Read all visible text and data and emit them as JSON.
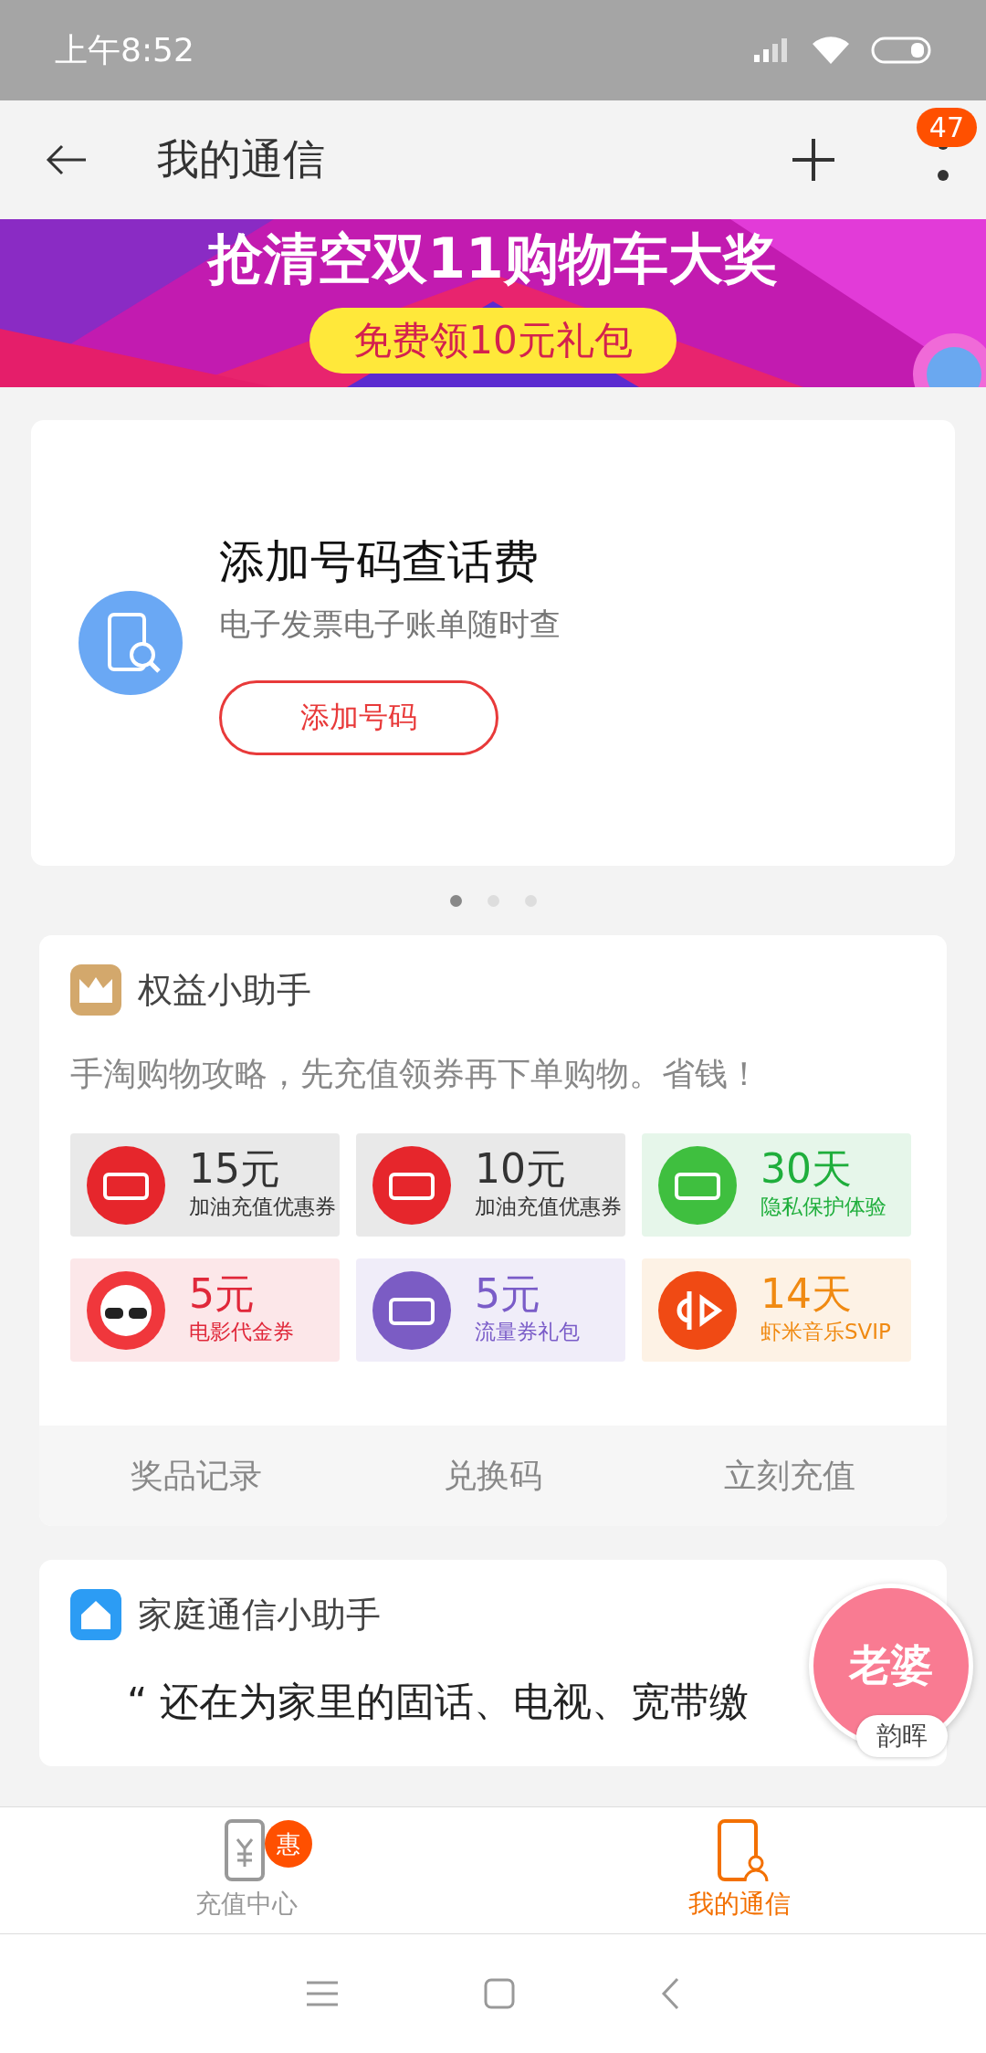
{
  "status_bar": {
    "time": "上午8:52"
  },
  "app_bar": {
    "title": "我的通信",
    "badge": "47"
  },
  "banner": {
    "headline": "抢清空双11购物车大奖",
    "button": "免费领10元礼包"
  },
  "carousel": {
    "title": "添加号码查话费",
    "subtitle": "电子发票电子账单随时查",
    "button": "添加号码",
    "dots": [
      {
        "selected": true
      },
      {
        "selected": false
      },
      {
        "selected": false
      }
    ]
  },
  "benefits": {
    "title": "权益小助手",
    "tip": "手淘购物攻略，先充值领券再下单购物。省钱！",
    "coupons": [
      {
        "kind": "fuel",
        "value": "15元",
        "label": "加油充值优惠券",
        "color": "#333333"
      },
      {
        "kind": "fuel",
        "value": "10元",
        "label": "加油充值优惠券",
        "color": "#333333"
      },
      {
        "kind": "privacy",
        "value": "30天",
        "label": "隐私保护体验",
        "color": "#1fae3c"
      },
      {
        "kind": "movie",
        "value": "5元",
        "label": "电影代金券",
        "color": "#e0283a"
      },
      {
        "kind": "data",
        "value": "5元",
        "label": "流量券礼包",
        "color": "#7a5cc8"
      },
      {
        "kind": "music",
        "value": "14天",
        "label": "虾米音乐SVIP",
        "color": "#f08a12"
      }
    ],
    "links": [
      "奖品记录",
      "兑换码",
      "立刻充值"
    ]
  },
  "family": {
    "title": "家庭通信小助手",
    "quote": "“ 还在为家里的固话、电视、宽带缴"
  },
  "floating_contact": {
    "name": "老婆",
    "caption": "韵晖"
  },
  "tabs": [
    {
      "label": "充值中心",
      "badge": "惠",
      "selected": false
    },
    {
      "label": "我的通信",
      "selected": true
    }
  ]
}
